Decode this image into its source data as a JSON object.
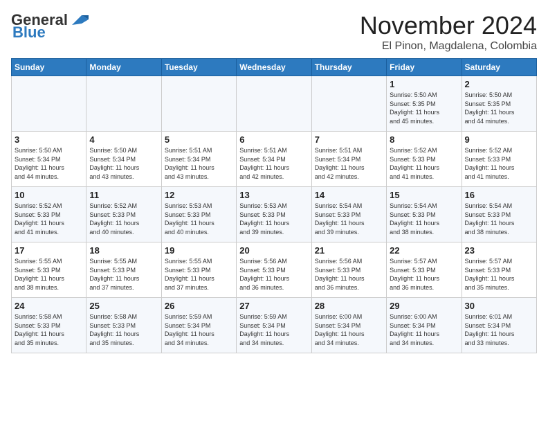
{
  "header": {
    "logo_line1": "General",
    "logo_line2": "Blue",
    "month": "November 2024",
    "location": "El Pinon, Magdalena, Colombia"
  },
  "weekdays": [
    "Sunday",
    "Monday",
    "Tuesday",
    "Wednesday",
    "Thursday",
    "Friday",
    "Saturday"
  ],
  "weeks": [
    [
      {
        "day": "",
        "info": ""
      },
      {
        "day": "",
        "info": ""
      },
      {
        "day": "",
        "info": ""
      },
      {
        "day": "",
        "info": ""
      },
      {
        "day": "",
        "info": ""
      },
      {
        "day": "1",
        "info": "Sunrise: 5:50 AM\nSunset: 5:35 PM\nDaylight: 11 hours\nand 45 minutes."
      },
      {
        "day": "2",
        "info": "Sunrise: 5:50 AM\nSunset: 5:35 PM\nDaylight: 11 hours\nand 44 minutes."
      }
    ],
    [
      {
        "day": "3",
        "info": "Sunrise: 5:50 AM\nSunset: 5:34 PM\nDaylight: 11 hours\nand 44 minutes."
      },
      {
        "day": "4",
        "info": "Sunrise: 5:50 AM\nSunset: 5:34 PM\nDaylight: 11 hours\nand 43 minutes."
      },
      {
        "day": "5",
        "info": "Sunrise: 5:51 AM\nSunset: 5:34 PM\nDaylight: 11 hours\nand 43 minutes."
      },
      {
        "day": "6",
        "info": "Sunrise: 5:51 AM\nSunset: 5:34 PM\nDaylight: 11 hours\nand 42 minutes."
      },
      {
        "day": "7",
        "info": "Sunrise: 5:51 AM\nSunset: 5:34 PM\nDaylight: 11 hours\nand 42 minutes."
      },
      {
        "day": "8",
        "info": "Sunrise: 5:52 AM\nSunset: 5:33 PM\nDaylight: 11 hours\nand 41 minutes."
      },
      {
        "day": "9",
        "info": "Sunrise: 5:52 AM\nSunset: 5:33 PM\nDaylight: 11 hours\nand 41 minutes."
      }
    ],
    [
      {
        "day": "10",
        "info": "Sunrise: 5:52 AM\nSunset: 5:33 PM\nDaylight: 11 hours\nand 41 minutes."
      },
      {
        "day": "11",
        "info": "Sunrise: 5:52 AM\nSunset: 5:33 PM\nDaylight: 11 hours\nand 40 minutes."
      },
      {
        "day": "12",
        "info": "Sunrise: 5:53 AM\nSunset: 5:33 PM\nDaylight: 11 hours\nand 40 minutes."
      },
      {
        "day": "13",
        "info": "Sunrise: 5:53 AM\nSunset: 5:33 PM\nDaylight: 11 hours\nand 39 minutes."
      },
      {
        "day": "14",
        "info": "Sunrise: 5:54 AM\nSunset: 5:33 PM\nDaylight: 11 hours\nand 39 minutes."
      },
      {
        "day": "15",
        "info": "Sunrise: 5:54 AM\nSunset: 5:33 PM\nDaylight: 11 hours\nand 38 minutes."
      },
      {
        "day": "16",
        "info": "Sunrise: 5:54 AM\nSunset: 5:33 PM\nDaylight: 11 hours\nand 38 minutes."
      }
    ],
    [
      {
        "day": "17",
        "info": "Sunrise: 5:55 AM\nSunset: 5:33 PM\nDaylight: 11 hours\nand 38 minutes."
      },
      {
        "day": "18",
        "info": "Sunrise: 5:55 AM\nSunset: 5:33 PM\nDaylight: 11 hours\nand 37 minutes."
      },
      {
        "day": "19",
        "info": "Sunrise: 5:55 AM\nSunset: 5:33 PM\nDaylight: 11 hours\nand 37 minutes."
      },
      {
        "day": "20",
        "info": "Sunrise: 5:56 AM\nSunset: 5:33 PM\nDaylight: 11 hours\nand 36 minutes."
      },
      {
        "day": "21",
        "info": "Sunrise: 5:56 AM\nSunset: 5:33 PM\nDaylight: 11 hours\nand 36 minutes."
      },
      {
        "day": "22",
        "info": "Sunrise: 5:57 AM\nSunset: 5:33 PM\nDaylight: 11 hours\nand 36 minutes."
      },
      {
        "day": "23",
        "info": "Sunrise: 5:57 AM\nSunset: 5:33 PM\nDaylight: 11 hours\nand 35 minutes."
      }
    ],
    [
      {
        "day": "24",
        "info": "Sunrise: 5:58 AM\nSunset: 5:33 PM\nDaylight: 11 hours\nand 35 minutes."
      },
      {
        "day": "25",
        "info": "Sunrise: 5:58 AM\nSunset: 5:33 PM\nDaylight: 11 hours\nand 35 minutes."
      },
      {
        "day": "26",
        "info": "Sunrise: 5:59 AM\nSunset: 5:34 PM\nDaylight: 11 hours\nand 34 minutes."
      },
      {
        "day": "27",
        "info": "Sunrise: 5:59 AM\nSunset: 5:34 PM\nDaylight: 11 hours\nand 34 minutes."
      },
      {
        "day": "28",
        "info": "Sunrise: 6:00 AM\nSunset: 5:34 PM\nDaylight: 11 hours\nand 34 minutes."
      },
      {
        "day": "29",
        "info": "Sunrise: 6:00 AM\nSunset: 5:34 PM\nDaylight: 11 hours\nand 34 minutes."
      },
      {
        "day": "30",
        "info": "Sunrise: 6:01 AM\nSunset: 5:34 PM\nDaylight: 11 hours\nand 33 minutes."
      }
    ]
  ]
}
